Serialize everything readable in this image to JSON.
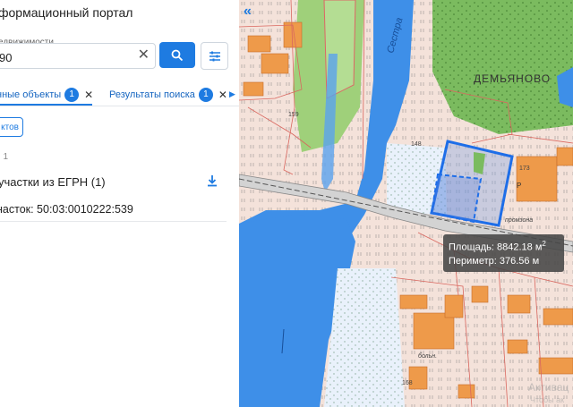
{
  "panel": {
    "title": "формационный портал",
    "search": {
      "label": "едвижимости",
      "value": "90"
    },
    "tabs": [
      {
        "label": "нные объекты",
        "badge": "1"
      },
      {
        "label": "Результаты поиска",
        "badge": "1"
      }
    ],
    "objects_button": "ктов",
    "count": ": 1",
    "section_title": "участки из ЕГРН (1)",
    "result_item": "насток: 50:03:0010222:539"
  },
  "map": {
    "labels": {
      "village": "ДЕМЬЯНОВО",
      "river": "Сестра",
      "n159": "159",
      "n148": "148",
      "n173": "173",
      "n168": "168",
      "road": "промзона",
      "hospital": "больн.",
      "p": "Р"
    },
    "tooltip": {
      "area_label": "Площадь: 8842.18 м",
      "area_sup": "2",
      "perimeter_label": "Периметр: 376.56 м"
    },
    "watermark": "Активац",
    "watermark_sub": "Чтобы ак"
  },
  "colors": {
    "accent": "#1e7be1",
    "parcel_outline": "#1e6ee8",
    "water": "#3e8fe8",
    "forest": "#6fae53"
  }
}
